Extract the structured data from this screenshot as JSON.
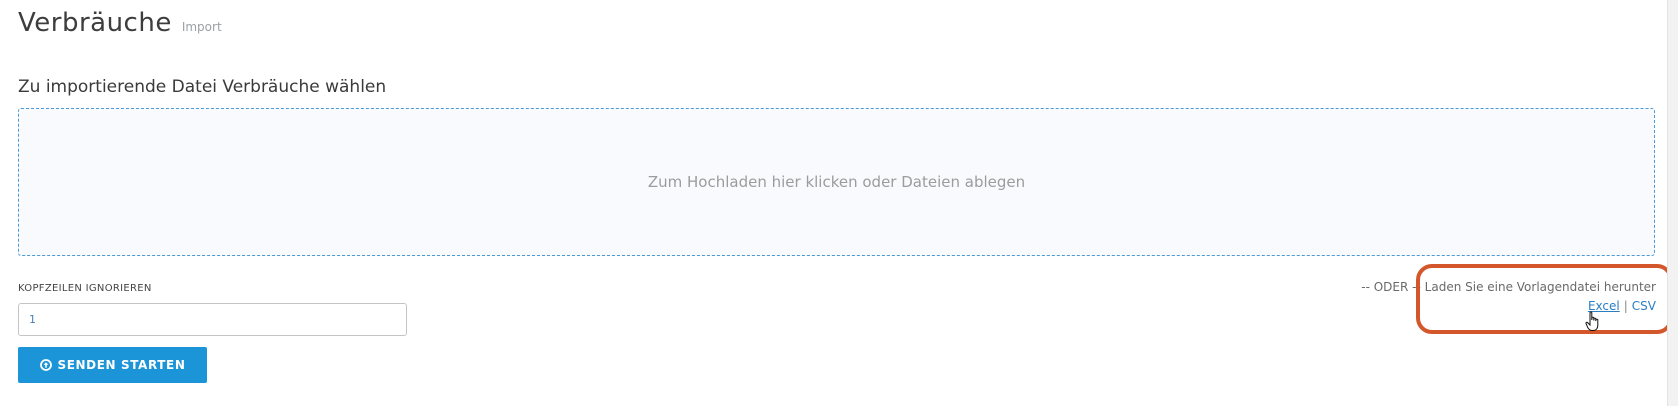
{
  "header": {
    "title": "Verbräuche",
    "subtitle": "Import"
  },
  "upload": {
    "section_title": "Zu importierende Datei Verbräuche wählen",
    "dropzone_text": "Zum Hochladen hier klicken oder Dateien ablegen"
  },
  "form": {
    "header_rows_label": "KOPFZEILEN IGNORIEREN",
    "header_rows_value": "1",
    "submit_label": "SENDEN STARTEN"
  },
  "template": {
    "prefix": "-- ODER --",
    "text": "Laden Sie eine Vorlagendatei herunter",
    "excel_label": "Excel",
    "separator": "|",
    "csv_label": "CSV"
  },
  "colors": {
    "accent": "#1b95d8",
    "link": "#2a7ec1",
    "highlight": "#d4562b",
    "dropzone_border": "#4a9ad6"
  },
  "icons": {
    "submit": "circle-arrow-up-icon",
    "cursor": "hand-pointer-icon"
  }
}
